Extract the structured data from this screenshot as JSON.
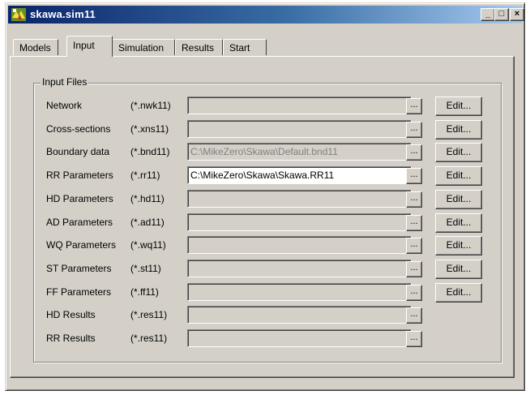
{
  "window": {
    "title": "skawa.sim11",
    "controls": {
      "minimize": "_",
      "maximize": "□",
      "close": "×"
    }
  },
  "tabs": [
    {
      "label": "Models",
      "active": false
    },
    {
      "label": "Input",
      "active": true
    },
    {
      "label": "Simulation",
      "active": false
    },
    {
      "label": "Results",
      "active": false
    },
    {
      "label": "Start",
      "active": false
    }
  ],
  "group": {
    "label": "Input Files"
  },
  "browse_label": "...",
  "edit_label": "Edit...",
  "rows": [
    {
      "label": "Network",
      "ext": "(*.nwk11)",
      "value": "",
      "active": false,
      "has_edit": true
    },
    {
      "label": "Cross-sections",
      "ext": "(*.xns11)",
      "value": "",
      "active": false,
      "has_edit": true
    },
    {
      "label": "Boundary data",
      "ext": "(*.bnd11)",
      "value": "C:\\MikeZero\\Skawa\\Default.bnd11",
      "active": false,
      "has_edit": true
    },
    {
      "label": "RR Parameters",
      "ext": "(*.rr11)",
      "value": "C:\\MikeZero\\Skawa\\Skawa.RR11",
      "active": true,
      "has_edit": true
    },
    {
      "label": "HD Parameters",
      "ext": "(*.hd11)",
      "value": "",
      "active": false,
      "has_edit": true
    },
    {
      "label": "AD Parameters",
      "ext": "(*.ad11)",
      "value": "",
      "active": false,
      "has_edit": true
    },
    {
      "label": "WQ Parameters",
      "ext": "(*.wq11)",
      "value": "",
      "active": false,
      "has_edit": true
    },
    {
      "label": "ST Parameters",
      "ext": "(*.st11)",
      "value": "",
      "active": false,
      "has_edit": true
    },
    {
      "label": "FF Parameters",
      "ext": "(*.ff11)",
      "value": "",
      "active": false,
      "has_edit": true
    },
    {
      "label": "HD Results",
      "ext": "(*.res11)",
      "value": "",
      "active": false,
      "has_edit": false
    },
    {
      "label": "RR Results",
      "ext": "(*.res11)",
      "value": "",
      "active": false,
      "has_edit": false
    }
  ]
}
